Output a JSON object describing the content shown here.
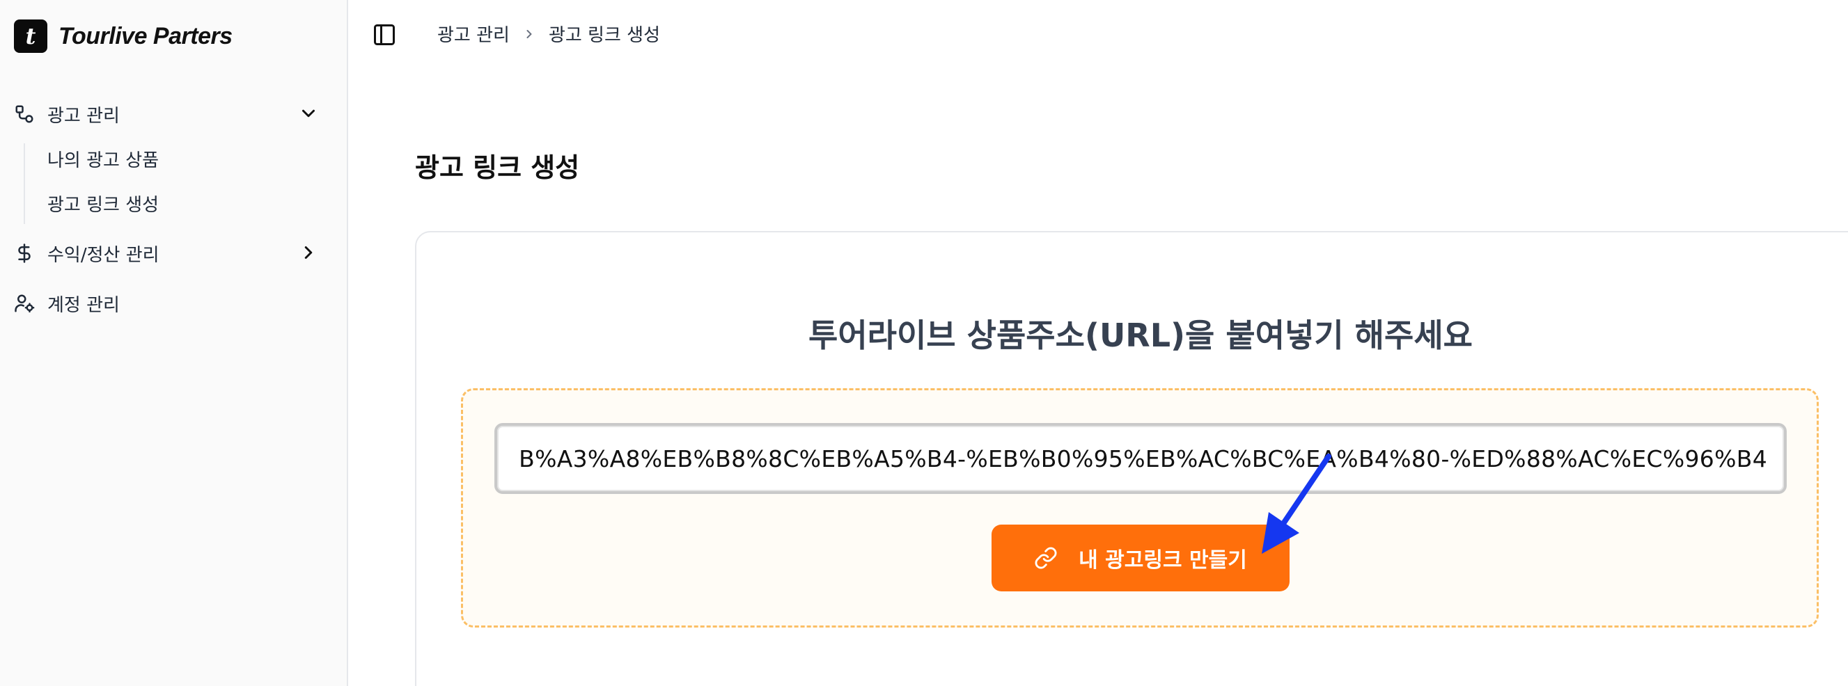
{
  "brand": {
    "logo_letter": "t",
    "name": "Tourlive Parters"
  },
  "sidebar": {
    "items": [
      {
        "label": "광고 관리",
        "icon": "workflow-icon",
        "expanded": true,
        "children": [
          {
            "label": "나의 광고 상품"
          },
          {
            "label": "광고 링크 생성"
          }
        ]
      },
      {
        "label": "수익/정산 관리",
        "icon": "dollar-icon",
        "expanded": false
      },
      {
        "label": "계정 관리",
        "icon": "user-cog-icon"
      }
    ]
  },
  "header": {
    "toggle_icon": "sidebar-toggle-icon",
    "breadcrumb": [
      "광고 관리",
      "광고 링크 생성"
    ]
  },
  "main": {
    "title": "광고 링크 생성",
    "prompt": "투어라이브 상품주소(URL)을 붙여넣기 해주세요",
    "url_value": "B%A3%A8%EB%B8%8C%EB%A5%B4-%EB%B0%95%EB%AC%BC%EA%B4%80-%ED%88%AC%EC%96%B4",
    "button_label": "내 광고링크 만들기",
    "button_icon": "link-icon"
  },
  "colors": {
    "accent": "#ff6f0b",
    "dashed_border": "#fbbf66",
    "annotation_arrow": "#1537f0"
  }
}
